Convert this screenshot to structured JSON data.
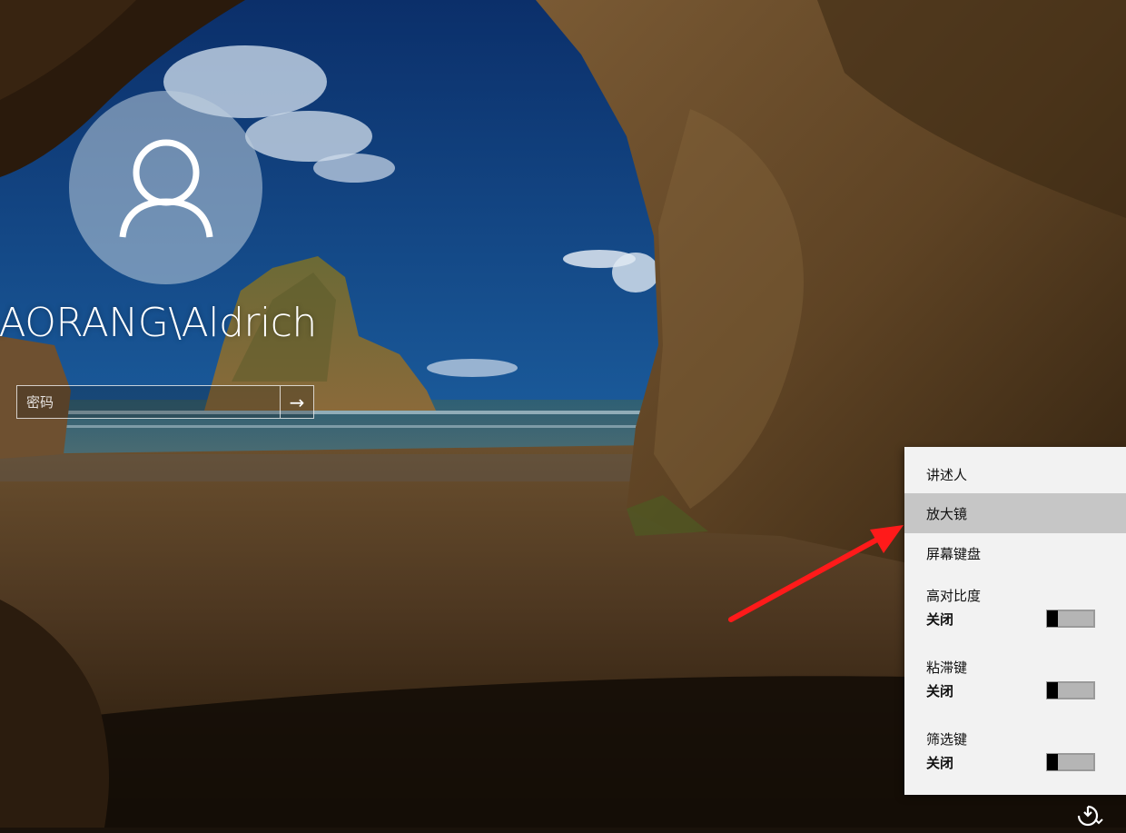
{
  "login": {
    "username": "IAORANG\\Aldrich",
    "password_placeholder": "密码",
    "submit_glyph": "→"
  },
  "ease_of_access_menu": {
    "items": [
      {
        "label": "讲述人"
      },
      {
        "label": "放大镜",
        "highlighted": true
      },
      {
        "label": "屏幕键盘"
      }
    ],
    "toggles": [
      {
        "label": "高对比度",
        "state": "关闭",
        "on": false
      },
      {
        "label": "粘滞键",
        "state": "关闭",
        "on": false
      },
      {
        "label": "筛选键",
        "state": "关闭",
        "on": false
      }
    ]
  },
  "colors": {
    "menu_bg": "#f2f2f2",
    "menu_highlight": "#c6c6c6",
    "annotation_arrow": "#ff1a1a"
  },
  "icons": {
    "avatar": "user-silhouette-icon",
    "submit": "arrow-right-icon",
    "ease_of_access": "ease-of-access-icon"
  }
}
